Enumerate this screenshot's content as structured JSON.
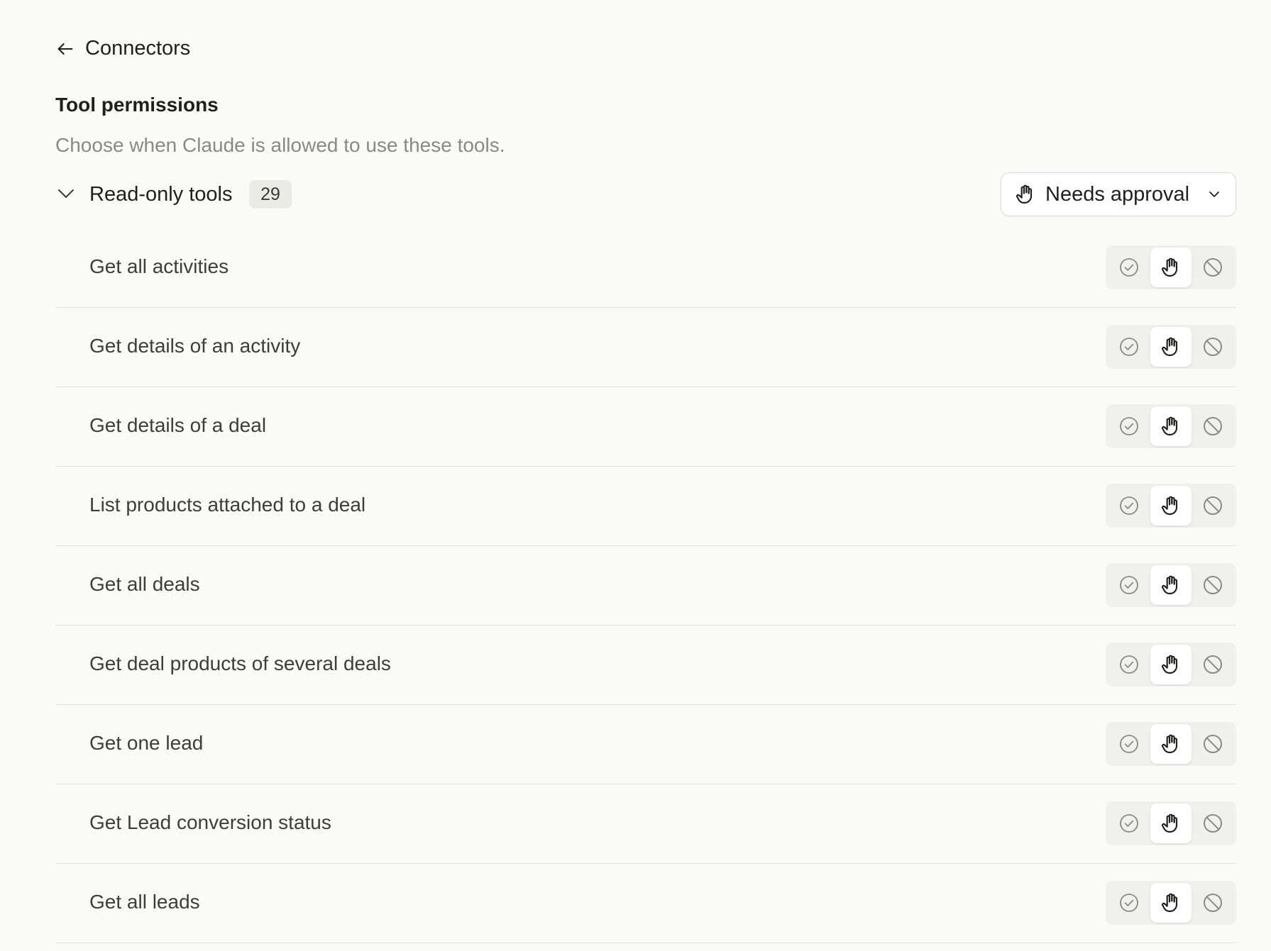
{
  "nav": {
    "back_label": "Connectors",
    "back_icon": "arrow-left-icon"
  },
  "section": {
    "title": "Tool permissions",
    "subtitle": "Choose when Claude is allowed to use these tools."
  },
  "group": {
    "label": "Read-only tools",
    "count": "29",
    "expanded": true,
    "dropdown": {
      "label": "Needs approval",
      "icon": "hand-icon"
    }
  },
  "permission_options": [
    {
      "id": "always-allow",
      "icon": "check-circle-icon"
    },
    {
      "id": "needs-approval",
      "icon": "hand-icon"
    },
    {
      "id": "blocked",
      "icon": "prohibited-icon"
    }
  ],
  "tools": [
    {
      "name": "Get all activities",
      "selected": "needs-approval"
    },
    {
      "name": "Get details of an activity",
      "selected": "needs-approval"
    },
    {
      "name": "Get details of a deal",
      "selected": "needs-approval"
    },
    {
      "name": "List products attached to a deal",
      "selected": "needs-approval"
    },
    {
      "name": "Get all deals",
      "selected": "needs-approval"
    },
    {
      "name": "Get deal products of several deals",
      "selected": "needs-approval"
    },
    {
      "name": "Get one lead",
      "selected": "needs-approval"
    },
    {
      "name": "Get Lead conversion status",
      "selected": "needs-approval"
    },
    {
      "name": "Get all leads",
      "selected": "needs-approval"
    }
  ],
  "colors": {
    "background": "#fafaf8",
    "text_primary": "#1f1f1c",
    "text_muted": "#8a8a85",
    "divider": "#e3e3de",
    "icon_muted": "#8c8c87"
  }
}
